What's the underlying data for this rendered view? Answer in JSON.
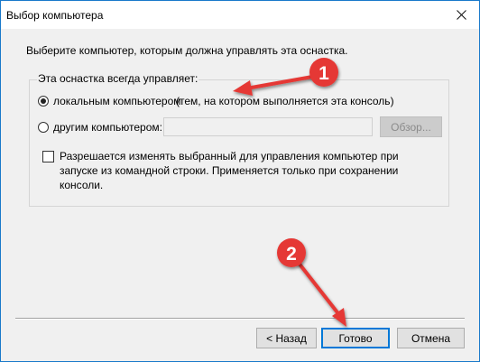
{
  "window": {
    "title": "Выбор компьютера",
    "instruction": "Выберите компьютер, которым должна управлять эта оснастка."
  },
  "group": {
    "label": "Эта оснастка всегда управляет:",
    "local_option": {
      "label": "локальным компьютером",
      "note": "(тем, на котором выполняется эта консоль)",
      "checked": true
    },
    "other_option": {
      "label": "другим компьютером:",
      "checked": false
    },
    "computer_field": {
      "value": "",
      "placeholder": ""
    },
    "browse_label": "Обзор...",
    "allow_checkbox": {
      "label": "Разрешается изменять выбранный для управления компьютер при запуске из командной строки. Применяется только при сохранении консоли.",
      "checked": false
    }
  },
  "footer": {
    "back_label": "< Назад",
    "finish_label": "Готово",
    "cancel_label": "Отмена"
  },
  "annotations": {
    "badge1": "1",
    "badge2": "2",
    "color": "#e53935"
  }
}
